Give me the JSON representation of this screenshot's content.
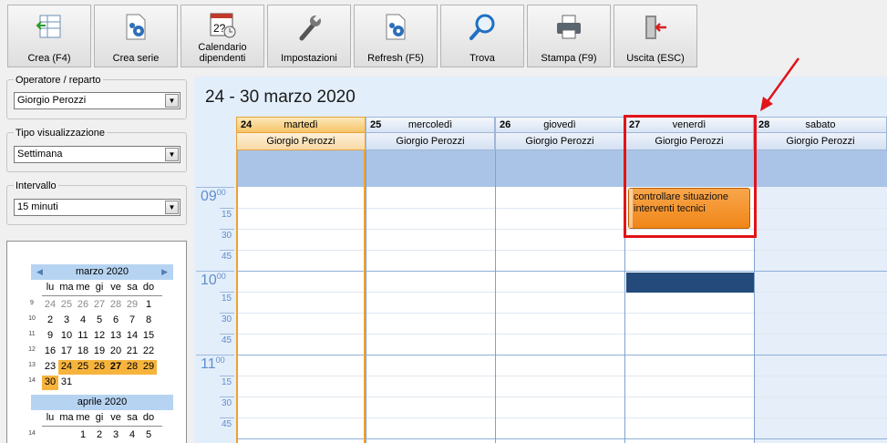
{
  "toolbar": {
    "buttons": [
      {
        "label": "Crea (F4)",
        "icon": "new-record-icon"
      },
      {
        "label": "Crea serie",
        "icon": "gear-document-icon"
      },
      {
        "label": "Calendario\ndipendenti",
        "icon": "calendar-icon",
        "icon_text": "2?"
      },
      {
        "label": "Impostazioni",
        "icon": "wrench-icon"
      },
      {
        "label": "Refresh (F5)",
        "icon": "refresh-document-icon"
      },
      {
        "label": "Trova",
        "icon": "search-icon"
      },
      {
        "label": "Stampa (F9)",
        "icon": "printer-icon"
      },
      {
        "label": "Uscita (ESC)",
        "icon": "exit-icon"
      }
    ]
  },
  "sidebar": {
    "operatore": {
      "label": "Operatore / reparto",
      "value": "Giorgio Perozzi"
    },
    "tipo": {
      "label": "Tipo visualizzazione",
      "value": "Settimana"
    },
    "intervallo": {
      "label": "Intervallo",
      "value": "15 minuti"
    }
  },
  "calendar": {
    "days_of_week": [
      "lu",
      "ma",
      "me",
      "gi",
      "ve",
      "sa",
      "do"
    ],
    "months": [
      {
        "name": "marzo 2020",
        "weeks": [
          {
            "num": "9",
            "days": [
              "24",
              "25",
              "26",
              "27",
              "28",
              "29",
              "1"
            ]
          },
          {
            "num": "10",
            "days": [
              "2",
              "3",
              "4",
              "5",
              "6",
              "7",
              "8"
            ]
          },
          {
            "num": "11",
            "days": [
              "9",
              "10",
              "11",
              "12",
              "13",
              "14",
              "15"
            ]
          },
          {
            "num": "12",
            "days": [
              "16",
              "17",
              "18",
              "19",
              "20",
              "21",
              "22"
            ]
          },
          {
            "num": "13",
            "days": [
              "23",
              "24",
              "25",
              "26",
              "27",
              "28",
              "29"
            ]
          },
          {
            "num": "14",
            "days": [
              "30",
              "31",
              "",
              "",
              "",
              "",
              ""
            ]
          }
        ]
      },
      {
        "name": "aprile 2020",
        "weeks": [
          {
            "num": "14",
            "days": [
              "",
              "",
              "1",
              "2",
              "3",
              "4",
              "5"
            ]
          }
        ]
      }
    ]
  },
  "schedule": {
    "title": "24 - 30 marzo 2020",
    "days": [
      {
        "num": "24",
        "name": "martedì",
        "person": "Giorgio Perozzi",
        "highlight": true
      },
      {
        "num": "25",
        "name": "mercoledì",
        "person": "Giorgio Perozzi"
      },
      {
        "num": "26",
        "name": "giovedì",
        "person": "Giorgio Perozzi"
      },
      {
        "num": "27",
        "name": "venerdì",
        "person": "Giorgio Perozzi"
      },
      {
        "num": "28",
        "name": "sabato",
        "person": "Giorgio Perozzi"
      }
    ],
    "hours": [
      "09",
      "10",
      "11"
    ],
    "minute_mark": "00",
    "minutes": [
      "15",
      "30",
      "45"
    ],
    "event": {
      "text": "controllare situazione interventi tecnici",
      "color": "#f08618"
    }
  },
  "colors": {
    "selected_day": "#f6b43d",
    "annotation": "#e11418",
    "busy": "#234a7b"
  }
}
